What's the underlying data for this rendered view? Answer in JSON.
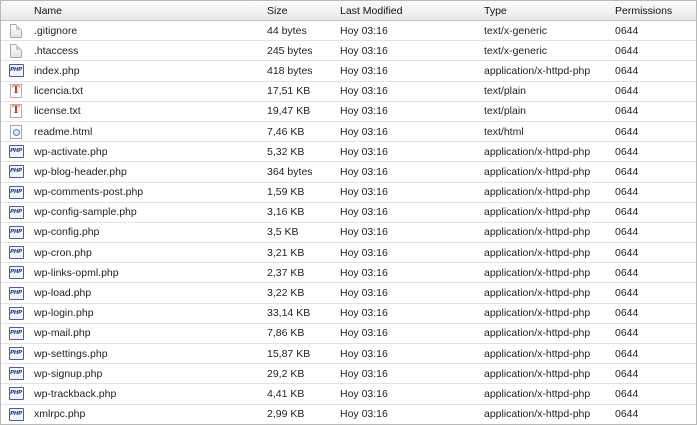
{
  "columns": {
    "name": "Name",
    "size": "Size",
    "modified": "Last Modified",
    "type": "Type",
    "permissions": "Permissions"
  },
  "files": [
    {
      "icon": "generic-file-icon",
      "name": ".gitignore",
      "size": "44 bytes",
      "modified": "Hoy 03:16",
      "type": "text/x-generic",
      "perm": "0644"
    },
    {
      "icon": "generic-file-icon",
      "name": ".htaccess",
      "size": "245 bytes",
      "modified": "Hoy 03:16",
      "type": "text/x-generic",
      "perm": "0644"
    },
    {
      "icon": "php-file-icon",
      "name": "index.php",
      "size": "418 bytes",
      "modified": "Hoy 03:16",
      "type": "application/x-httpd-php",
      "perm": "0644"
    },
    {
      "icon": "text-file-icon",
      "name": "licencia.txt",
      "size": "17,51 KB",
      "modified": "Hoy 03:16",
      "type": "text/plain",
      "perm": "0644"
    },
    {
      "icon": "text-file-icon",
      "name": "license.txt",
      "size": "19,47 KB",
      "modified": "Hoy 03:16",
      "type": "text/plain",
      "perm": "0644"
    },
    {
      "icon": "html-file-icon",
      "name": "readme.html",
      "size": "7,46 KB",
      "modified": "Hoy 03:16",
      "type": "text/html",
      "perm": "0644"
    },
    {
      "icon": "php-file-icon",
      "name": "wp-activate.php",
      "size": "5,32 KB",
      "modified": "Hoy 03:16",
      "type": "application/x-httpd-php",
      "perm": "0644"
    },
    {
      "icon": "php-file-icon",
      "name": "wp-blog-header.php",
      "size": "364 bytes",
      "modified": "Hoy 03:16",
      "type": "application/x-httpd-php",
      "perm": "0644"
    },
    {
      "icon": "php-file-icon",
      "name": "wp-comments-post.php",
      "size": "1,59 KB",
      "modified": "Hoy 03:16",
      "type": "application/x-httpd-php",
      "perm": "0644"
    },
    {
      "icon": "php-file-icon",
      "name": "wp-config-sample.php",
      "size": "3,16 KB",
      "modified": "Hoy 03:16",
      "type": "application/x-httpd-php",
      "perm": "0644"
    },
    {
      "icon": "php-file-icon",
      "name": "wp-config.php",
      "size": "3,5 KB",
      "modified": "Hoy 03:16",
      "type": "application/x-httpd-php",
      "perm": "0644"
    },
    {
      "icon": "php-file-icon",
      "name": "wp-cron.php",
      "size": "3,21 KB",
      "modified": "Hoy 03:16",
      "type": "application/x-httpd-php",
      "perm": "0644"
    },
    {
      "icon": "php-file-icon",
      "name": "wp-links-opml.php",
      "size": "2,37 KB",
      "modified": "Hoy 03:16",
      "type": "application/x-httpd-php",
      "perm": "0644"
    },
    {
      "icon": "php-file-icon",
      "name": "wp-load.php",
      "size": "3,22 KB",
      "modified": "Hoy 03:16",
      "type": "application/x-httpd-php",
      "perm": "0644"
    },
    {
      "icon": "php-file-icon",
      "name": "wp-login.php",
      "size": "33,14 KB",
      "modified": "Hoy 03:16",
      "type": "application/x-httpd-php",
      "perm": "0644"
    },
    {
      "icon": "php-file-icon",
      "name": "wp-mail.php",
      "size": "7,86 KB",
      "modified": "Hoy 03:16",
      "type": "application/x-httpd-php",
      "perm": "0644"
    },
    {
      "icon": "php-file-icon",
      "name": "wp-settings.php",
      "size": "15,87 KB",
      "modified": "Hoy 03:16",
      "type": "application/x-httpd-php",
      "perm": "0644"
    },
    {
      "icon": "php-file-icon",
      "name": "wp-signup.php",
      "size": "29,2 KB",
      "modified": "Hoy 03:16",
      "type": "application/x-httpd-php",
      "perm": "0644"
    },
    {
      "icon": "php-file-icon",
      "name": "wp-trackback.php",
      "size": "4,41 KB",
      "modified": "Hoy 03:16",
      "type": "application/x-httpd-php",
      "perm": "0644"
    },
    {
      "icon": "php-file-icon",
      "name": "xmlrpc.php",
      "size": "2,99 KB",
      "modified": "Hoy 03:16",
      "type": "application/x-httpd-php",
      "perm": "0644"
    }
  ]
}
